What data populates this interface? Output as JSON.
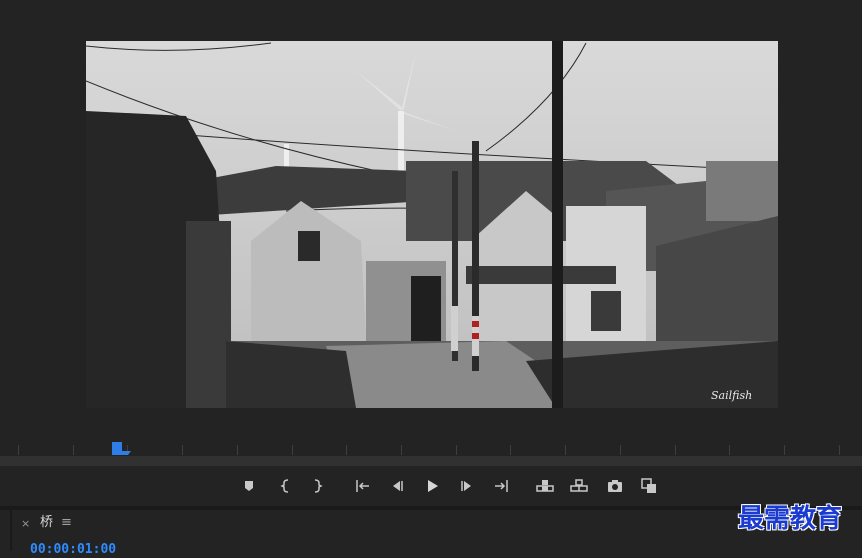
{
  "panel": {
    "close_label": "×",
    "title": "桥",
    "menu_icon": "≡",
    "timecode": "00:00:01:00"
  },
  "program_monitor": {
    "frame_signature": "Sailfish"
  },
  "transport": {
    "buttons": [
      {
        "name": "add-marker-icon"
      },
      {
        "name": "mark-in-icon"
      },
      {
        "name": "mark-out-icon"
      },
      {
        "name": "go-to-in-icon"
      },
      {
        "name": "step-back-icon"
      },
      {
        "name": "play-icon"
      },
      {
        "name": "step-forward-icon"
      },
      {
        "name": "go-to-out-icon"
      },
      {
        "name": "lift-icon"
      },
      {
        "name": "extract-icon"
      },
      {
        "name": "export-frame-icon"
      },
      {
        "name": "comparison-view-icon"
      }
    ]
  },
  "watermark": {
    "text": "最需教育"
  },
  "colors": {
    "background": "#232323",
    "timecode": "#2f8cff",
    "playhead": "#2f7ee8",
    "watermark": "#1a3ad0"
  }
}
